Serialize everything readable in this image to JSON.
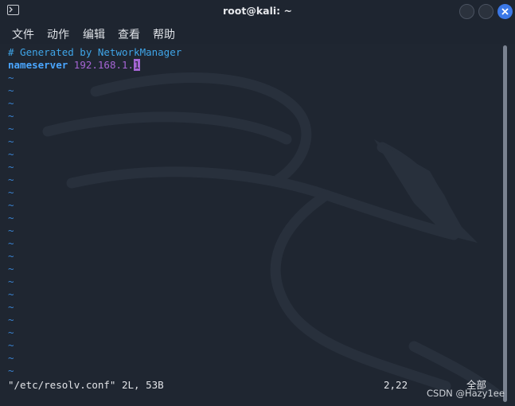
{
  "window": {
    "title": "root@kali: ~"
  },
  "menu": {
    "items": [
      "文件",
      "动作",
      "编辑",
      "查看",
      "帮助"
    ]
  },
  "editor": {
    "line1": "# Generated by NetworkManager",
    "line2_keyword": "nameserver",
    "line2_value": "192.168.1.",
    "line2_cursor_char": "1",
    "tilde": "~",
    "tilde_count": 24
  },
  "statusline": {
    "file_info": "\"/etc/resolv.conf\" 2L, 53B",
    "position": "2,22",
    "scroll": "全部"
  },
  "watermark": "CSDN @Hazy1ee",
  "colors": {
    "background": "#1f2631",
    "comment": "#3fa5e8",
    "keyword": "#4aa6ff",
    "ip": "#a565d4",
    "tilde": "#3a82d0",
    "close_button": "#3b78e7"
  }
}
